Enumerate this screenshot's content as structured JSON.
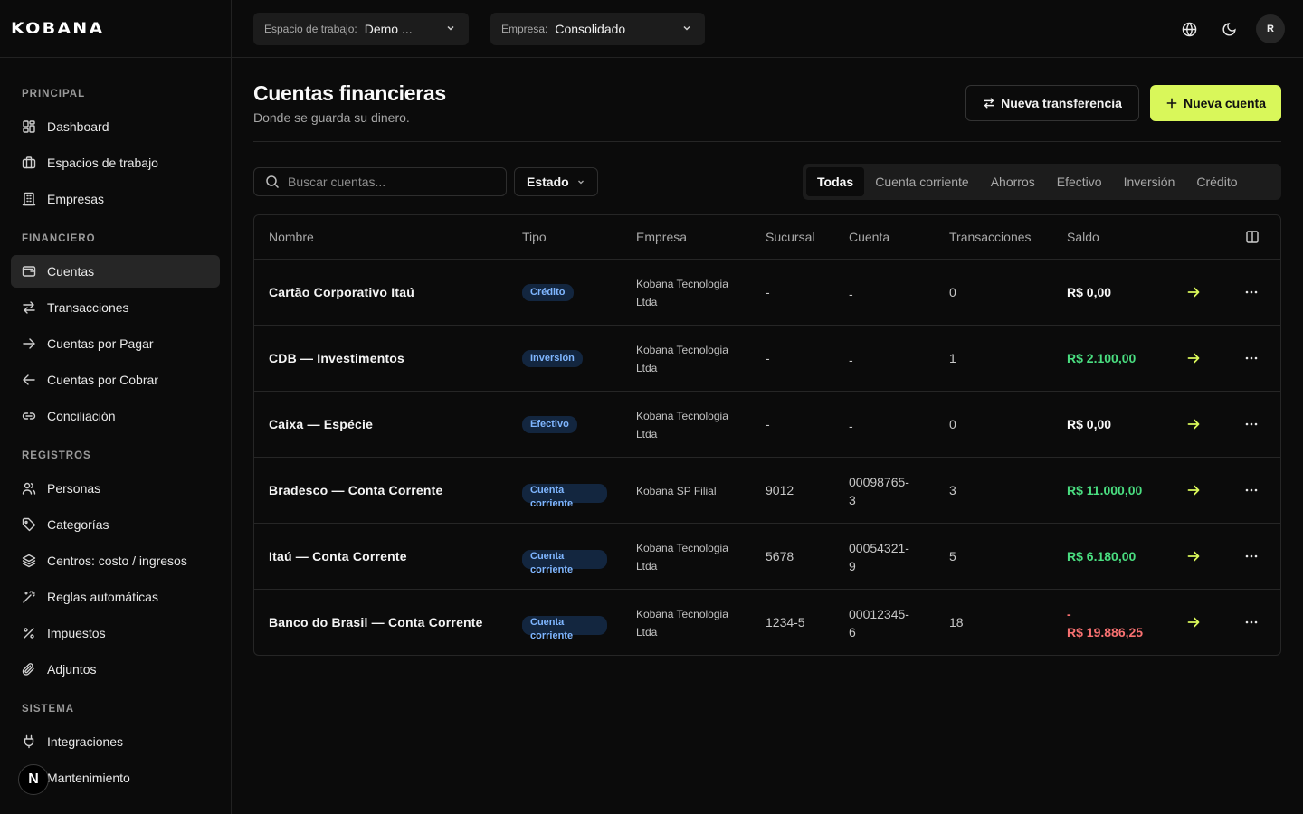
{
  "brand": {
    "name": "KOBANA"
  },
  "topbar": {
    "workspace_label": "Espacio de trabajo:",
    "workspace_value": "Demo ...",
    "company_label": "Empresa:",
    "company_value": "Consolidado",
    "avatar_initial": "R"
  },
  "sidebar": {
    "sections": [
      {
        "title": "PRINCIPAL",
        "items": [
          {
            "label": "Dashboard",
            "icon": "dashboard-icon"
          },
          {
            "label": "Espacios de trabajo",
            "icon": "briefcase-icon"
          },
          {
            "label": "Empresas",
            "icon": "building-icon"
          }
        ]
      },
      {
        "title": "FINANCIERO",
        "items": [
          {
            "label": "Cuentas",
            "icon": "wallet-icon",
            "active": true
          },
          {
            "label": "Transacciones",
            "icon": "arrows-exchange-icon"
          },
          {
            "label": "Cuentas por Pagar",
            "icon": "arrow-right-icon"
          },
          {
            "label": "Cuentas por Cobrar",
            "icon": "arrow-left-icon"
          },
          {
            "label": "Conciliación",
            "icon": "link-icon"
          }
        ]
      },
      {
        "title": "REGISTROS",
        "items": [
          {
            "label": "Personas",
            "icon": "users-icon"
          },
          {
            "label": "Categorías",
            "icon": "tag-icon"
          },
          {
            "label": "Centros: costo / ingresos",
            "icon": "layers-icon"
          },
          {
            "label": "Reglas automáticas",
            "icon": "magic-wand-icon"
          },
          {
            "label": "Impuestos",
            "icon": "percent-icon"
          },
          {
            "label": "Adjuntos",
            "icon": "paperclip-icon"
          }
        ]
      },
      {
        "title": "SISTEMA",
        "items": [
          {
            "label": "Integraciones",
            "icon": "plug-icon"
          },
          {
            "label": "Mantenimiento",
            "icon": "wrench-icon"
          }
        ]
      }
    ],
    "next_badge": "N"
  },
  "page": {
    "title": "Cuentas financieras",
    "subtitle": "Donde se guarda su dinero.",
    "transfer_button": "Nueva transferencia",
    "new_account_button": "Nueva cuenta"
  },
  "filters": {
    "search_placeholder": "Buscar cuentas...",
    "status_label": "Estado",
    "tabs": [
      "Todas",
      "Cuenta corriente",
      "Ahorros",
      "Efectivo",
      "Inversión",
      "Crédito"
    ],
    "active_tab": "Todas"
  },
  "table": {
    "columns": [
      "Nombre",
      "Tipo",
      "Empresa",
      "Sucursal",
      "Cuenta",
      "Transacciones",
      "Saldo"
    ],
    "rows": [
      {
        "name": "Cartão Corporativo Itaú",
        "type": "Crédito",
        "company": [
          "Kobana Tecnologia",
          "Ltda"
        ],
        "branch": "-",
        "account": [
          "-"
        ],
        "transactions": "0",
        "balance": [
          "R$ 0,00"
        ],
        "balance_kind": "zero"
      },
      {
        "name": "CDB — Investimentos",
        "type": "Inversión",
        "company": [
          "Kobana Tecnologia",
          "Ltda"
        ],
        "branch": "-",
        "account": [
          "-"
        ],
        "transactions": "1",
        "balance": [
          "R$ 2.100,00"
        ],
        "balance_kind": "pos"
      },
      {
        "name": "Caixa — Espécie",
        "type": "Efectivo",
        "company": [
          "Kobana Tecnologia",
          "Ltda"
        ],
        "branch": "-",
        "account": [
          "-"
        ],
        "transactions": "0",
        "balance": [
          "R$ 0,00"
        ],
        "balance_kind": "zero"
      },
      {
        "name": "Bradesco — Conta Corrente",
        "type": "Cuenta corriente",
        "company": [
          "Kobana SP Filial"
        ],
        "branch": "9012",
        "account": [
          "00098765-",
          "3"
        ],
        "transactions": "3",
        "balance": [
          "R$ 11.000,00"
        ],
        "balance_kind": "pos"
      },
      {
        "name": "Itaú — Conta Corrente",
        "type": "Cuenta corriente",
        "company": [
          "Kobana Tecnologia",
          "Ltda"
        ],
        "branch": "5678",
        "account": [
          "00054321-",
          "9"
        ],
        "transactions": "5",
        "balance": [
          "R$ 6.180,00"
        ],
        "balance_kind": "pos"
      },
      {
        "name": "Banco do Brasil — Conta Corrente",
        "type": "Cuenta corriente",
        "company": [
          "Kobana Tecnologia",
          "Ltda"
        ],
        "branch": "1234-5",
        "account": [
          "00012345-",
          "6"
        ],
        "transactions": "18",
        "balance": [
          "-",
          "R$ 19.886,25"
        ],
        "balance_kind": "neg"
      }
    ]
  },
  "colors": {
    "accent": "#d9f75a",
    "positive": "#4ade80",
    "negative": "#f87171",
    "badge_bg": "#13263f",
    "badge_text": "#7fb6ff"
  }
}
